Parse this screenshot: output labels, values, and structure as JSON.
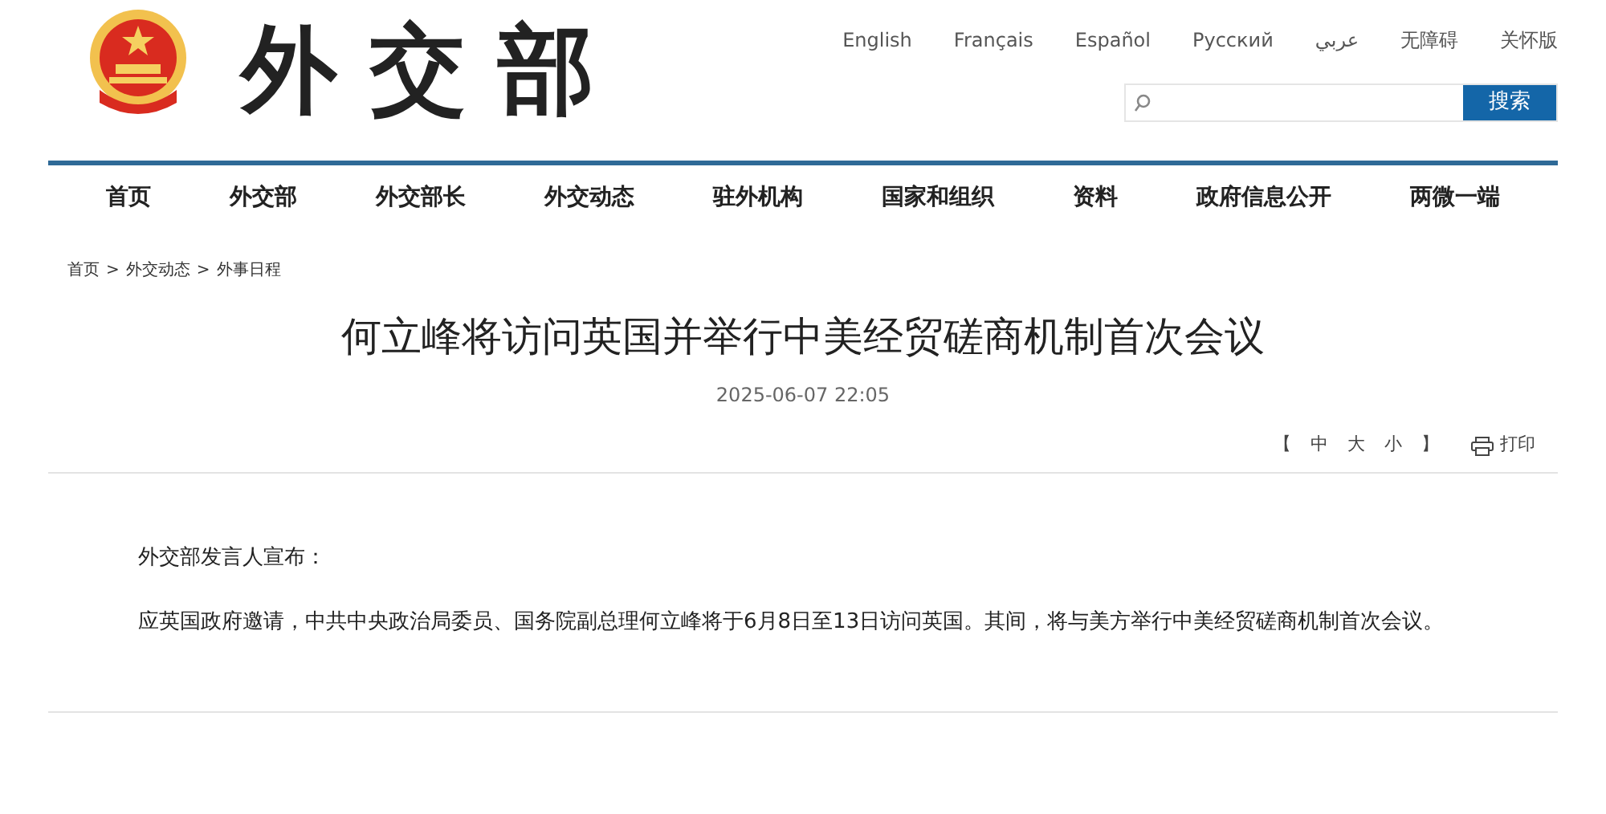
{
  "header": {
    "logo_text": "外交部",
    "languages": [
      "English",
      "Français",
      "Español",
      "Русский",
      "عربي",
      "无障碍",
      "关怀版"
    ],
    "search": {
      "button": "搜索"
    }
  },
  "nav": [
    "首页",
    "外交部",
    "外交部长",
    "外交动态",
    "驻外机构",
    "国家和组织",
    "资料",
    "政府信息公开",
    "两微一端"
  ],
  "breadcrumb": [
    "首页",
    "外交动态",
    "外事日程"
  ],
  "breadcrumb_separator": ">",
  "article": {
    "title": "何立峰将访问英国并举行中美经贸磋商机制首次会议",
    "date": "2025-06-07 22:05",
    "font_size": {
      "open": "【",
      "options": [
        "中",
        "大",
        "小"
      ],
      "close": "】"
    },
    "print": "打印",
    "paragraphs": [
      "外交部发言人宣布：",
      "应英国政府邀请，中共中央政治局委员、国务院副总理何立峰将于6月8日至13日访问英国。其间，将与美方举行中美经贸磋商机制首次会议。"
    ]
  }
}
